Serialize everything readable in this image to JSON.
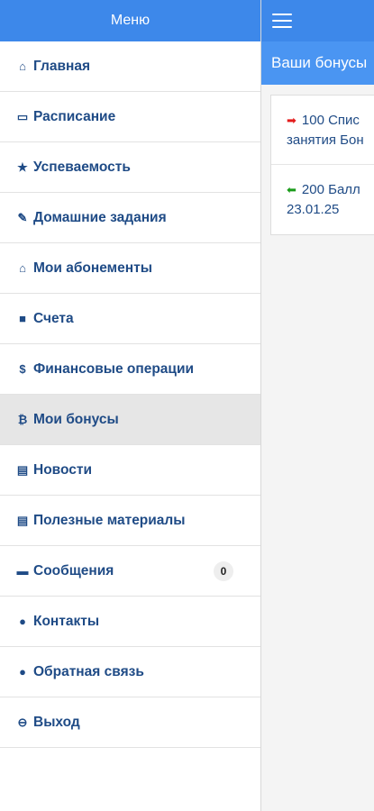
{
  "sidebar": {
    "title": "Меню",
    "items": [
      {
        "icon": "home-icon",
        "glyph": "⌂",
        "label": "Главная",
        "active": false
      },
      {
        "icon": "calendar-icon",
        "glyph": "▭",
        "label": "Расписание",
        "active": false
      },
      {
        "icon": "star-icon",
        "glyph": "★",
        "label": "Успеваемость",
        "active": false
      },
      {
        "icon": "edit-icon",
        "glyph": "✎",
        "label": "Домашние задания",
        "active": false
      },
      {
        "icon": "lock-icon",
        "glyph": "⌂",
        "label": "Мои абонементы",
        "active": false
      },
      {
        "icon": "book-icon",
        "glyph": "■",
        "label": "Счета",
        "active": false
      },
      {
        "icon": "dollar-icon",
        "glyph": "$",
        "label": "Финансовые операции",
        "active": false
      },
      {
        "icon": "bitcoin-icon",
        "glyph": "₿",
        "label": "Мои бонусы",
        "active": true
      },
      {
        "icon": "news-icon",
        "glyph": "▤",
        "label": "Новости",
        "active": false
      },
      {
        "icon": "book-open-icon",
        "glyph": "▤",
        "label": "Полезные материалы",
        "active": false
      },
      {
        "icon": "comment-icon",
        "glyph": "▬",
        "label": "Сообщения",
        "active": false,
        "badge": "0"
      },
      {
        "icon": "map-marker-icon",
        "glyph": "●",
        "label": "Контакты",
        "active": false
      },
      {
        "icon": "microphone-icon",
        "glyph": "●",
        "label": "Обратная связь",
        "active": false
      },
      {
        "icon": "logout-icon",
        "glyph": "⊖",
        "label": "Выход",
        "active": false
      }
    ]
  },
  "main": {
    "panel_title": "Ваши бонусы",
    "entries": [
      {
        "direction": "out",
        "icon": "arrow-right-icon",
        "glyph": "➡",
        "color": "#e31b1b",
        "line1": "100  Спис",
        "line2": "занятия Бон"
      },
      {
        "direction": "in",
        "icon": "arrow-left-icon",
        "glyph": "⬅",
        "color": "#1a9b1a",
        "line1": "200  Балл",
        "line2": "23.01.25"
      }
    ]
  },
  "colors": {
    "header": "#3d88ea",
    "panel_header": "#4a95f2",
    "menu_text": "#1f4b86",
    "active_bg": "#e6e6e6"
  }
}
